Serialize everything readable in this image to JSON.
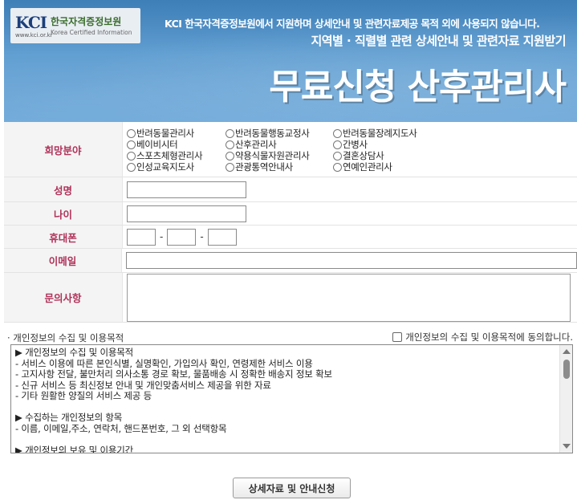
{
  "header": {
    "logo_text": "KCI",
    "logo_url": "www.kci.or.kr",
    "logo_kor": "한국자격증정보원",
    "logo_eng": "Korea Certified Information",
    "notice": "KCI 한국자격증정보원에서 지원하며 상세안내 및 관련자료제공 목적 외에 사용되지 않습니다.",
    "sub_title": "지역별 · 직렬별 관련 상세안내 및 관련자료 지원받기",
    "main_title": "무료신청 산후관리사"
  },
  "form": {
    "field_label": "희망분야",
    "options": [
      "반려동물관리사",
      "반려동물행동교정사",
      "반려동물장례지도사",
      "베이비시터",
      "산후관리사",
      "간병사",
      "스포츠체형관리사",
      "약용식물자원관리사",
      "결혼상담사",
      "인성교육지도사",
      "관광통역안내사",
      "연예인관리사"
    ],
    "name_label": "성명",
    "age_label": "나이",
    "phone_label": "휴대폰",
    "phone_separator": "-",
    "email_label": "이메일",
    "inquiry_label": "문의사항"
  },
  "privacy": {
    "title": "· 개인정보의 수집 및 이용목적",
    "agree_label": "개인정보의 수집 및 이용목적에 동의합니다.",
    "text": "▶ 개인정보의 수집 및 이용목적\n- 서비스 이용에 따른 본인식별, 실명확인, 가입의사 확인, 연령제한 서비스 이용\n- 고지사항 전달, 불만처리 의사소통 경로 확보, 물품배송 시 정확한 배송지 정보 확보\n- 신규 서비스 등 최신정보 안내 및 개인맞춤서비스 제공을 위한 자료\n- 기타 원활한 양질의 서비스 제공 등\n\n▶ 수집하는 개인정보의 항목\n- 이름, 이메일,주소, 연락처, 핸드폰번호, 그 외 선택항목\n\n▶ 개인정보의 보유 및 이용기간"
  },
  "submit_label": "상세자료 및 안내신청"
}
